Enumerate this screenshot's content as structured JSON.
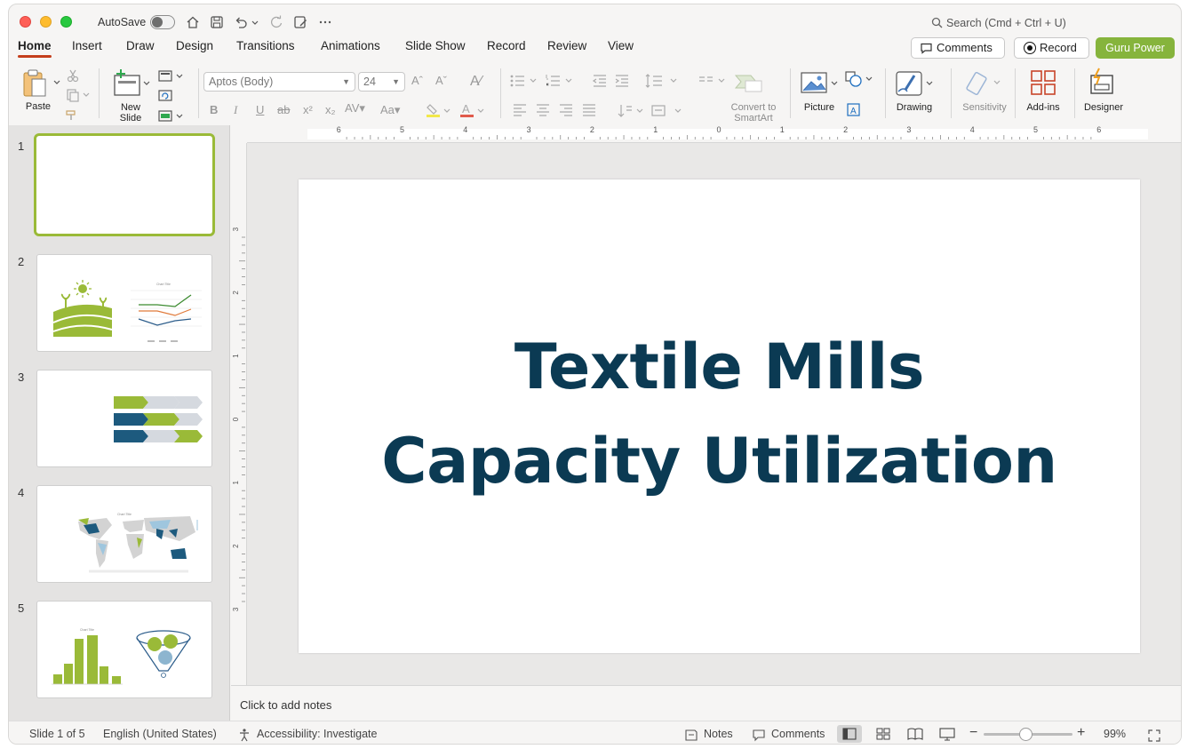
{
  "titlebar": {
    "autosave_label": "AutoSave",
    "search_placeholder": "Search (Cmd + Ctrl + U)"
  },
  "tabs": [
    "Home",
    "Insert",
    "Draw",
    "Design",
    "Transitions",
    "Animations",
    "Slide Show",
    "Record",
    "Review",
    "View"
  ],
  "header_buttons": {
    "comments": "Comments",
    "record": "Record",
    "guru_power": "Guru Power"
  },
  "ribbon": {
    "paste": "Paste",
    "new_slide_line1": "New",
    "new_slide_line2": "Slide",
    "font_name": "Aptos (Body)",
    "font_size": "24",
    "convert_line1": "Convert to",
    "convert_line2": "SmartArt",
    "picture": "Picture",
    "drawing": "Drawing",
    "sensitivity": "Sensitivity",
    "addins": "Add-ins",
    "designer": "Designer"
  },
  "thumbnails": [
    {
      "number": "1"
    },
    {
      "number": "2",
      "chart_title": "Chart Title"
    },
    {
      "number": "3"
    },
    {
      "number": "4",
      "chart_title": "Chart Title"
    },
    {
      "number": "5",
      "chart_title": "Chart Title"
    }
  ],
  "ruler": {
    "horizontal": [
      "6",
      "5",
      "4",
      "3",
      "2",
      "1",
      "0",
      "1",
      "2",
      "3",
      "4",
      "5",
      "6"
    ],
    "vertical": [
      "3",
      "2",
      "1",
      "0",
      "1",
      "2",
      "3"
    ]
  },
  "slide": {
    "title_line1": "Textile Mills",
    "title_line2": "Capacity Utilization"
  },
  "notes_placeholder": "Click to add notes",
  "statusbar": {
    "slide_info": "Slide 1 of 5",
    "language": "English (United States)",
    "accessibility": "Accessibility: Investigate",
    "notes": "Notes",
    "comments": "Comments",
    "zoom": "99%"
  },
  "colors": {
    "accent_green": "#86b43c",
    "title_navy": "#0b3a53",
    "tab_underline": "#c43e1c"
  }
}
